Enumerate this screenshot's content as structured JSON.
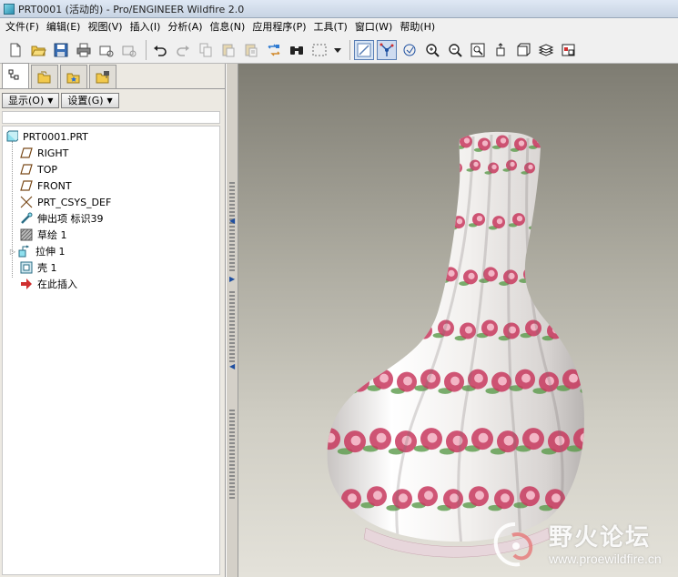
{
  "window": {
    "title": "PRT0001 (活动的) - Pro/ENGINEER Wildfire 2.0"
  },
  "menu": {
    "items": [
      {
        "label": "文件(F)"
      },
      {
        "label": "编辑(E)"
      },
      {
        "label": "视图(V)"
      },
      {
        "label": "插入(I)"
      },
      {
        "label": "分析(A)"
      },
      {
        "label": "信息(N)"
      },
      {
        "label": "应用程序(P)"
      },
      {
        "label": "工具(T)"
      },
      {
        "label": "窗口(W)"
      },
      {
        "label": "帮助(H)"
      }
    ]
  },
  "toolbar": {
    "buttons": [
      {
        "icon": "new-file-icon"
      },
      {
        "icon": "open-folder-icon"
      },
      {
        "icon": "save-icon"
      },
      {
        "icon": "print-icon"
      },
      {
        "icon": "send-mail-icon"
      },
      {
        "icon": "send-mail-2-icon"
      },
      {
        "icon": "undo-icon"
      },
      {
        "icon": "redo-icon"
      },
      {
        "icon": "copy-icon"
      },
      {
        "icon": "paste-icon"
      },
      {
        "icon": "paste-special-icon"
      },
      {
        "icon": "regenerate-icon"
      },
      {
        "icon": "find-icon"
      },
      {
        "icon": "select-box-icon"
      },
      {
        "icon": "dropdown-icon"
      },
      {
        "icon": "datum-display-icon"
      },
      {
        "icon": "spin-center-icon"
      },
      {
        "icon": "orient-icon"
      },
      {
        "icon": "zoom-in-icon"
      },
      {
        "icon": "zoom-out-icon"
      },
      {
        "icon": "refit-icon"
      },
      {
        "icon": "reorient-icon"
      },
      {
        "icon": "saved-views-icon"
      },
      {
        "icon": "layers-icon"
      },
      {
        "icon": "view-manager-icon"
      }
    ]
  },
  "panel": {
    "tabs": [
      {
        "icon": "model-tree-icon",
        "active": true
      },
      {
        "icon": "folder-browser-icon",
        "active": false
      },
      {
        "icon": "favorites-icon",
        "active": false
      },
      {
        "icon": "connections-icon",
        "active": false
      }
    ],
    "show_label": "显示(O)",
    "settings_label": "设置(G)"
  },
  "tree": {
    "root": {
      "label": "PRT0001.PRT",
      "icon": "part-icon"
    },
    "items": [
      {
        "label": "RIGHT",
        "icon": "datum-plane-icon"
      },
      {
        "label": "TOP",
        "icon": "datum-plane-icon"
      },
      {
        "label": "FRONT",
        "icon": "datum-plane-icon"
      },
      {
        "label": "PRT_CSYS_DEF",
        "icon": "csys-icon"
      },
      {
        "label": "伸出项 标识39",
        "icon": "protrusion-icon"
      },
      {
        "label": "草绘 1",
        "icon": "sketch-icon"
      },
      {
        "label": "拉伸 1",
        "icon": "extrude-icon",
        "expandable": true
      },
      {
        "label": "壳 1",
        "icon": "shell-icon"
      },
      {
        "label": "在此插入",
        "icon": "insert-here-icon"
      }
    ]
  },
  "colors": {
    "rose": "#c8385e",
    "leaf": "#5a9a4a",
    "vase_white": "#f6f4f2",
    "graphics_top": "#7e7c72",
    "graphics_bottom": "#e4e2da"
  },
  "watermark": {
    "title": "野火论坛",
    "url": "www.proewildfire.cn"
  }
}
